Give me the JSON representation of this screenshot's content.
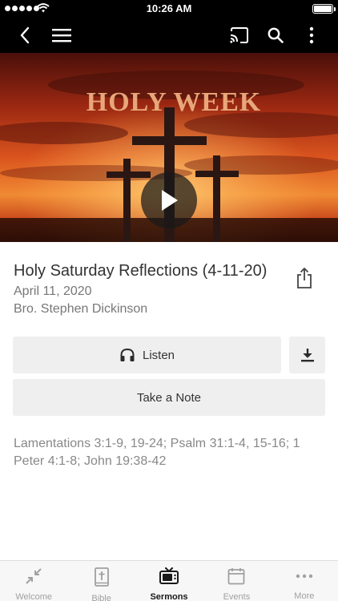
{
  "status_bar": {
    "time": "10:26 AM"
  },
  "video": {
    "overlay_title": "HOLY WEEK"
  },
  "sermon": {
    "title": "Holy Saturday Reflections (4-11-20)",
    "date": "April 11, 2020",
    "speaker": "Bro. Stephen Dickinson",
    "scripture": "Lamentations 3:1-9, 19-24; Psalm 31:1-4, 15-16; 1 Peter 4:1-8; John 19:38-42"
  },
  "actions": {
    "listen_label": "Listen",
    "note_label": "Take a Note"
  },
  "tabs": [
    {
      "label": "Welcome",
      "icon": "compress-arrows-icon"
    },
    {
      "label": "Bible",
      "icon": "bible-icon"
    },
    {
      "label": "Sermons",
      "icon": "tv-icon",
      "active": true
    },
    {
      "label": "Events",
      "icon": "calendar-icon"
    },
    {
      "label": "More",
      "icon": "ellipsis-icon"
    }
  ],
  "colors": {
    "nav_background": "#000000",
    "button_background": "#efefef",
    "active_tab": "#1a1a1a",
    "inactive_tab": "#a0a0a0"
  }
}
